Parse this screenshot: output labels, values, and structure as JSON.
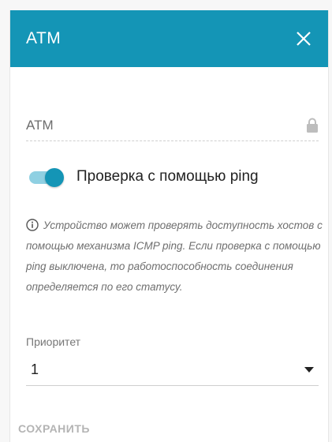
{
  "dialog": {
    "title": "ATM",
    "close_icon": "close-icon"
  },
  "atm_field": {
    "value": "ATM",
    "lock_icon": "lock-icon"
  },
  "ping_toggle": {
    "enabled": true,
    "label": "Проверка с помощью ping"
  },
  "info": {
    "icon": "info-icon",
    "text": "Устройство может проверять доступность хостов с помощью механизма ICMP ping. Если проверка с помощью ping выключена, то работоспособность соединения определяется по его статусу."
  },
  "priority": {
    "label": "Приоритет",
    "selected": "1"
  },
  "save_label": "СОХРАНИТЬ",
  "colors": {
    "accent": "#1495b6",
    "toggle_track": "#8fd0e2"
  }
}
